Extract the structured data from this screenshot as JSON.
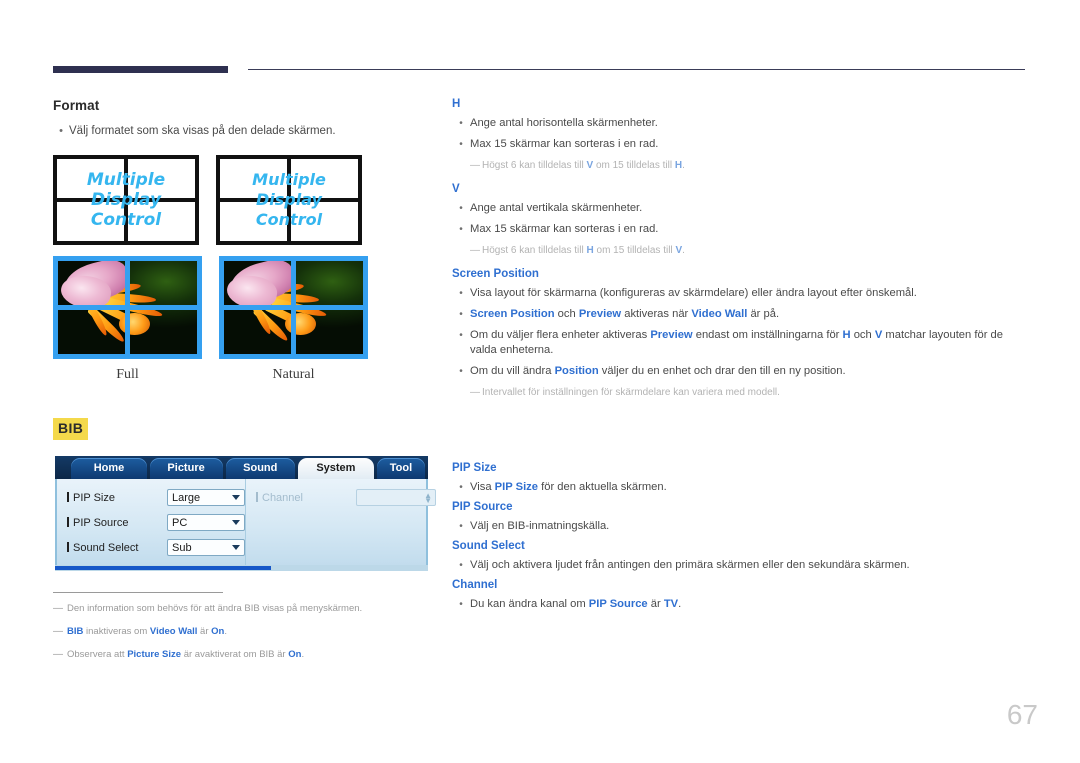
{
  "page": {
    "number": "67"
  },
  "left": {
    "format": {
      "heading": "Format",
      "bullet": "Välj formatet som ska visas på den delade skärmen.",
      "diagram_text_line1": "Multiple",
      "diagram_text_line2": "Display",
      "diagram_text_line3": "Control",
      "caption_full": "Full",
      "caption_natural": "Natural"
    },
    "bib": {
      "tag": "BIB",
      "osd": {
        "tabs": [
          "Home",
          "Picture",
          "Sound",
          "System",
          "Tool"
        ],
        "selected_tab": "System",
        "rows": [
          {
            "label": "PIP Size",
            "value": "Large"
          },
          {
            "label": "PIP Source",
            "value": "PC"
          },
          {
            "label": "Sound Select",
            "value": "Sub"
          }
        ],
        "right_label": "Channel",
        "right_value": ""
      },
      "footnotes": [
        {
          "parts": [
            {
              "t": "Den information som behövs för att ändra BIB visas på menyskärmen.",
              "b": false
            }
          ]
        },
        {
          "parts": [
            {
              "t": "BIB",
              "b": true
            },
            {
              "t": " inaktiveras om ",
              "b": false
            },
            {
              "t": "Video Wall",
              "b": true
            },
            {
              "t": " är ",
              "b": false
            },
            {
              "t": "On",
              "b": true
            },
            {
              "t": ".",
              "b": false
            }
          ]
        },
        {
          "parts": [
            {
              "t": "Observera att ",
              "b": false
            },
            {
              "t": "Picture Size",
              "b": true
            },
            {
              "t": " är avaktiverat om BIB är ",
              "b": false
            },
            {
              "t": "On",
              "b": true
            },
            {
              "t": ".",
              "b": false
            }
          ]
        }
      ]
    }
  },
  "right": {
    "h_section": {
      "heading": "H",
      "bullets": [
        "Ange antal horisontella skärmenheter.",
        "Max 15 skärmar kan sorteras i en rad."
      ],
      "note_parts": [
        {
          "t": "Högst 6 kan tilldelas till ",
          "b": false
        },
        {
          "t": "V",
          "b": true
        },
        {
          "t": " om 15 tilldelas till ",
          "b": false
        },
        {
          "t": "H",
          "b": true
        },
        {
          "t": ".",
          "b": false
        }
      ]
    },
    "v_section": {
      "heading": "V",
      "bullets": [
        "Ange antal vertikala skärmenheter.",
        "Max 15 skärmar kan sorteras i en rad."
      ],
      "note_parts": [
        {
          "t": "Högst 6 kan tilldelas till ",
          "b": false
        },
        {
          "t": "H",
          "b": true
        },
        {
          "t": " om 15 tilldelas till ",
          "b": false
        },
        {
          "t": "V",
          "b": true
        },
        {
          "t": ".",
          "b": false
        }
      ]
    },
    "screen_position": {
      "heading": "Screen Position",
      "bullets": [
        [
          {
            "t": "Visa layout för skärmarna (konfigureras av skärmdelare) eller ändra layout efter önskemål.",
            "b": false
          }
        ],
        [
          {
            "t": "Screen Position",
            "b": true
          },
          {
            "t": " och ",
            "b": false
          },
          {
            "t": "Preview",
            "b": true
          },
          {
            "t": " aktiveras när ",
            "b": false
          },
          {
            "t": "Video Wall",
            "b": true
          },
          {
            "t": " är på.",
            "b": false
          }
        ],
        [
          {
            "t": "Om du väljer flera enheter aktiveras ",
            "b": false
          },
          {
            "t": "Preview",
            "b": true
          },
          {
            "t": " endast om inställningarna för ",
            "b": false
          },
          {
            "t": "H",
            "b": true
          },
          {
            "t": " och ",
            "b": false
          },
          {
            "t": "V",
            "b": true
          },
          {
            "t": " matchar layouten för de valda enheterna.",
            "b": false
          }
        ],
        [
          {
            "t": "Om du vill ändra ",
            "b": false
          },
          {
            "t": "Position",
            "b": true
          },
          {
            "t": " väljer du en enhet och drar den till en ny position.",
            "b": false
          }
        ]
      ],
      "note_parts": [
        {
          "t": "Intervallet för inställningen för skärmdelare kan variera med modell.",
          "b": false
        }
      ]
    },
    "pip_size": {
      "heading": "PIP Size",
      "bullet_parts": [
        {
          "t": "Visa ",
          "b": false
        },
        {
          "t": "PIP Size",
          "b": true
        },
        {
          "t": " för den aktuella skärmen.",
          "b": false
        }
      ]
    },
    "pip_source": {
      "heading": "PIP Source",
      "bullet_parts": [
        {
          "t": "Välj en BIB-inmatningskälla.",
          "b": false
        }
      ]
    },
    "sound_select": {
      "heading": "Sound Select",
      "bullet_parts": [
        {
          "t": "Välj och aktivera ljudet från antingen den primära skärmen eller den sekundära skärmen.",
          "b": false
        }
      ]
    },
    "channel": {
      "heading": "Channel",
      "bullet_parts": [
        {
          "t": "Du kan ändra kanal om ",
          "b": false
        },
        {
          "t": "PIP Source",
          "b": true
        },
        {
          "t": " är ",
          "b": false
        },
        {
          "t": "TV",
          "b": true
        },
        {
          "t": ".",
          "b": false
        }
      ]
    }
  },
  "colors": {
    "accent_blue": "#2f6fd0",
    "header_navy": "#2e3050",
    "highlight_yellow": "#f4d94b",
    "screen_blue": "#35a0f0",
    "overlay_cyan": "#35b6ef"
  }
}
